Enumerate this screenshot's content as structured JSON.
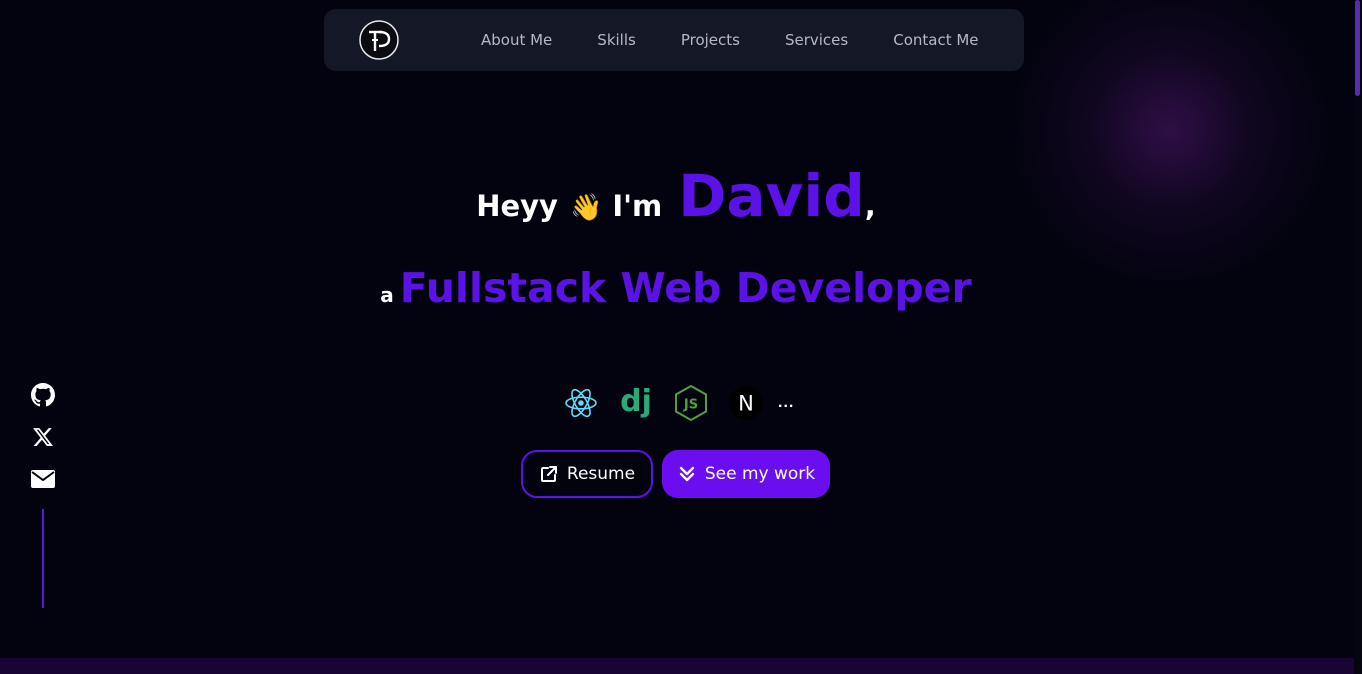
{
  "nav": {
    "logo_icon": "td-monogram-logo",
    "links": [
      {
        "label": "About Me"
      },
      {
        "label": "Skills"
      },
      {
        "label": "Projects"
      },
      {
        "label": "Services"
      },
      {
        "label": "Contact Me"
      }
    ]
  },
  "hero": {
    "greeting": "Heyy",
    "wave_emoji": "👋",
    "im": "I'm",
    "name": "David",
    "comma": ",",
    "article": "a",
    "role": "Fullstack Web Developer"
  },
  "tech_stack": {
    "icons": [
      "react-icon",
      "django-icon",
      "nodejs-icon",
      "nextjs-icon"
    ],
    "django_text": "dj",
    "node_text": "JS",
    "next_text": "N",
    "more": "..."
  },
  "buttons": {
    "resume_label": "Resume",
    "resume_icon": "external-link-icon",
    "work_label": "See my work",
    "work_icon": "double-chevron-down-icon"
  },
  "social": {
    "icons": [
      "github-icon",
      "x-twitter-icon",
      "mail-icon"
    ]
  },
  "colors": {
    "background": "#03030f",
    "navbar": "#141726",
    "accent": "#5b12e6",
    "button_primary": "#6a0ef0",
    "nav_text": "#b6b8c6",
    "react": "#61dafb",
    "django": "#2ba977",
    "node": "#539e43"
  }
}
